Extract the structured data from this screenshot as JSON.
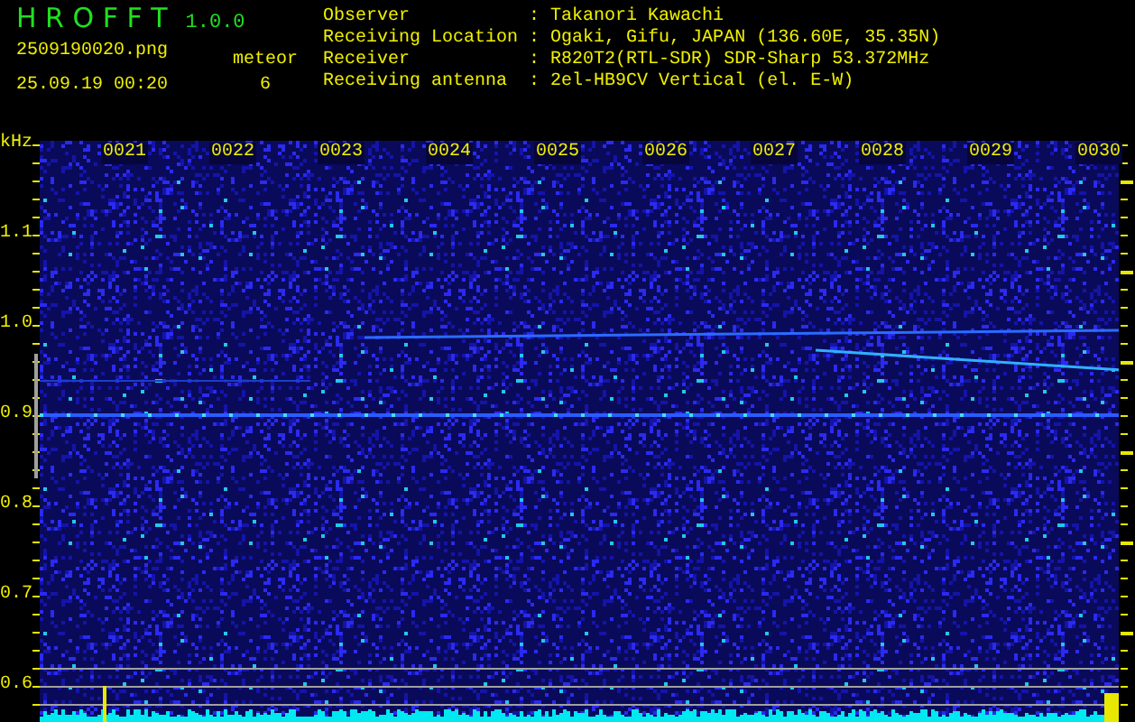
{
  "app": {
    "title": "H R O F F T",
    "version": "1.0.0"
  },
  "file": {
    "name": "2509190020.png",
    "timestamp": "25.09.19 00:20"
  },
  "meteor": {
    "label": "meteor",
    "count": "6"
  },
  "station": [
    {
      "label": "Observer",
      "separator": ":",
      "value": "Takanori Kawachi"
    },
    {
      "label": "Receiving Location",
      "separator": ":",
      "value": "Ogaki, Gifu, JAPAN (136.60E, 35.35N)"
    },
    {
      "label": "Receiver",
      "separator": ":",
      "value": "R820T2(RTL-SDR) SDR-Sharp 53.372MHz"
    },
    {
      "label": "Receiving antenna",
      "separator": ":",
      "value": "2el-HB9CV Vertical (el. E-W)"
    }
  ],
  "frequency_axis": {
    "unit": "kHz",
    "labels": [
      "1.1",
      "1.0",
      "0.9",
      "0.8",
      "0.7",
      "0.6"
    ]
  },
  "time_labels": [
    "0021",
    "0022",
    "0023",
    "0024",
    "0025",
    "0026",
    "0027",
    "0028",
    "0029",
    "0030"
  ]
}
